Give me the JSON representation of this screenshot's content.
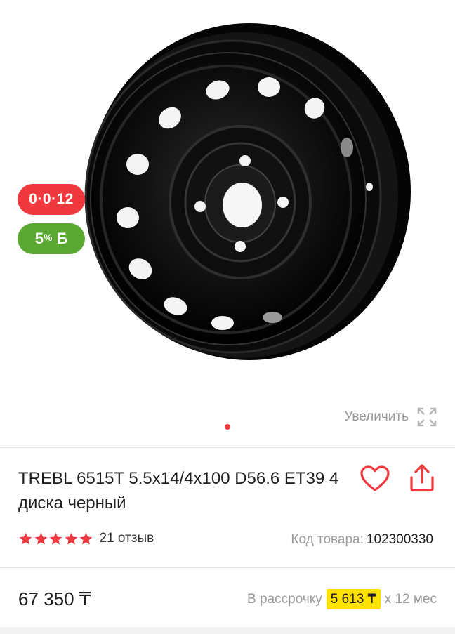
{
  "badges": {
    "installment": "0·0·12",
    "bonus_percent": "5",
    "bonus_percent_sign": "%",
    "bonus_currency": "Б"
  },
  "gallery": {
    "zoom_label": "Увеличить",
    "zoom_icon": "expand-arrows-icon",
    "image": "black steel wheel rim"
  },
  "product": {
    "title": "TREBL 6515T 5.5x14/4x100 D56.6 ET39 4 диска черный",
    "rating": 5,
    "reviews": "21 отзыв",
    "sku_label": "Код товара:",
    "sku_value": "102300330",
    "price": "67 350 ₸",
    "installment_prefix": "В рассрочку",
    "installment_amount": "5 613 ₸",
    "installment_suffix": "x 12 мес"
  },
  "icons": {
    "favorite": "heart-icon",
    "share": "share-icon",
    "star": "star-icon"
  },
  "colors": {
    "accent_red": "#f0393e",
    "bonus_green": "#5aa731",
    "installment_highlight": "#ffe200"
  }
}
